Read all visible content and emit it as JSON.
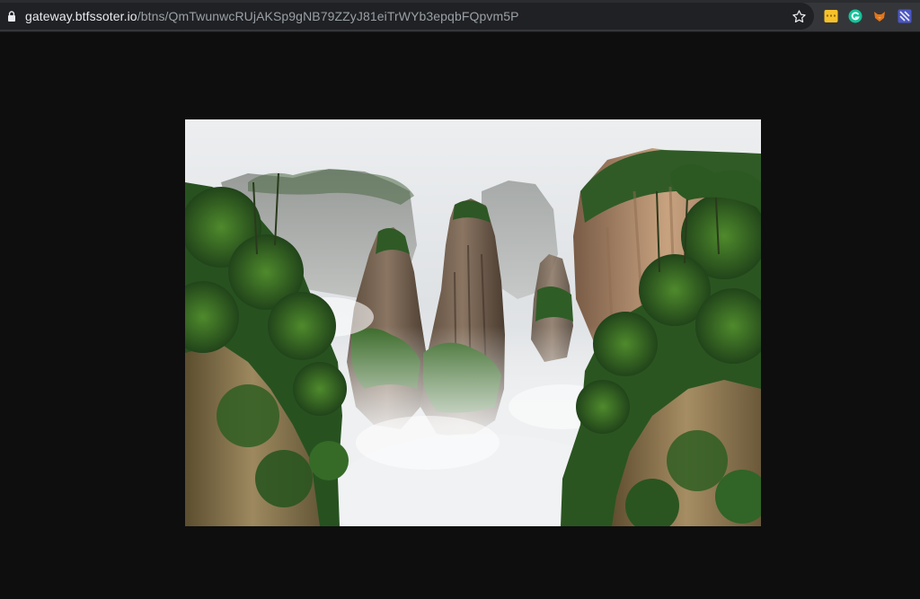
{
  "browser": {
    "url_host": "gateway.btfssoter.io",
    "url_path": "/btns/QmTwunwcRUjAKSp9gNB79ZZyJ81eiTrWYb3epqbFQpvm5P",
    "icons": {
      "lock": "lock-icon",
      "bookmark": "star-icon",
      "extensions": [
        "notes-extension-icon",
        "grammarly-extension-icon",
        "fox-extension-icon",
        "reader-extension-icon"
      ]
    },
    "colors": {
      "toolbar": "#35363a",
      "omnibox": "#202124",
      "page_background": "#0e0e0e"
    }
  },
  "content": {
    "image": "misty-karst-pillars-photo",
    "description_icon": "photo-image"
  }
}
